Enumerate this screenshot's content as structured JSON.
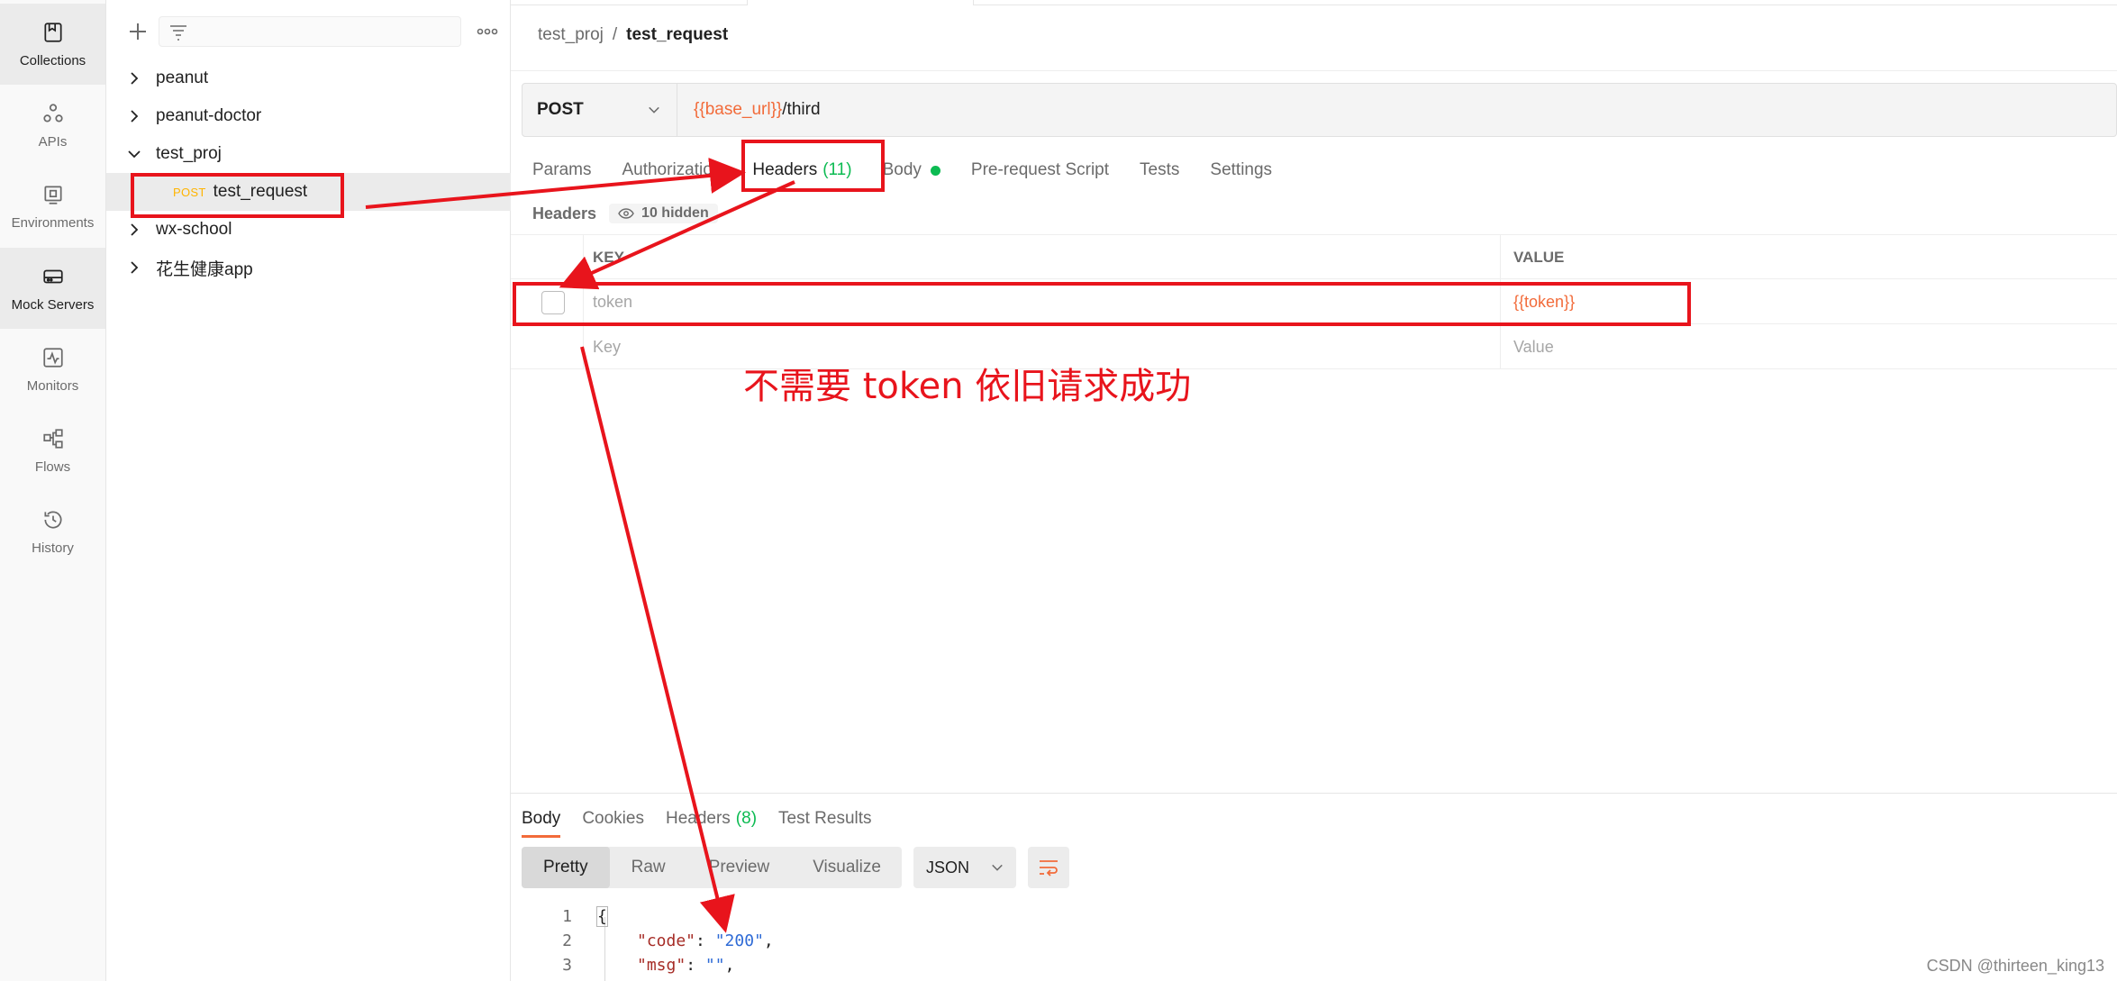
{
  "rail": {
    "items": [
      {
        "label": "Collections",
        "icon": "collections-icon",
        "active": true
      },
      {
        "label": "APIs",
        "icon": "apis-icon"
      },
      {
        "label": "Environments",
        "icon": "environments-icon"
      },
      {
        "label": "Mock Servers",
        "icon": "mock-servers-icon",
        "active": true
      },
      {
        "label": "Monitors",
        "icon": "monitors-icon"
      },
      {
        "label": "Flows",
        "icon": "flows-icon"
      },
      {
        "label": "History",
        "icon": "history-icon"
      }
    ]
  },
  "sidebar": {
    "tree": [
      {
        "label": "peanut",
        "expanded": false
      },
      {
        "label": "peanut-doctor",
        "expanded": false
      },
      {
        "label": "test_proj",
        "expanded": true
      },
      {
        "method": "POST",
        "label": "test_request",
        "selected": true
      },
      {
        "label": "wx-school",
        "expanded": false
      },
      {
        "label": "花生健康app",
        "expanded": false
      }
    ]
  },
  "request": {
    "breadcrumb": {
      "parent": "test_proj",
      "separator": "/",
      "current": "test_request"
    },
    "method": "POST",
    "url_var": "{{base_url}}",
    "url_rest": "/third",
    "tabs": {
      "params": "Params",
      "authorization": "Authorization",
      "headers": "Headers",
      "headers_count": "(11)",
      "body": "Body",
      "pre_request": "Pre-request Script",
      "tests": "Tests",
      "settings": "Settings"
    },
    "headers_label": "Headers",
    "hidden_label": "10 hidden",
    "table": {
      "key_header": "KEY",
      "value_header": "VALUE",
      "row_key": "token",
      "row_value": "{{token}}",
      "placeholder_key": "Key",
      "placeholder_value": "Value"
    }
  },
  "response": {
    "tabs": {
      "body": "Body",
      "cookies": "Cookies",
      "headers": "Headers",
      "headers_count": "(8)",
      "test_results": "Test Results"
    },
    "views": [
      "Pretty",
      "Raw",
      "Preview",
      "Visualize"
    ],
    "format": "JSON",
    "code": {
      "ln1": "1",
      "ln2": "2",
      "ln3": "3",
      "line1": "{",
      "line2_key": "\"code\"",
      "line2_sep": ": ",
      "line2_val": "\"200\"",
      "line2_end": ",",
      "line3_key": "\"msg\"",
      "line3_sep": ": ",
      "line3_val": "\"\"",
      "line3_end": ","
    }
  },
  "annotation": {
    "text": "不需要 token 依旧请求成功",
    "color": "#e8141c"
  },
  "watermark": "CSDN @thirteen_king13",
  "colors": {
    "accent": "#f26b3a",
    "green": "#0cbb52",
    "method_post": "#ffb400"
  }
}
